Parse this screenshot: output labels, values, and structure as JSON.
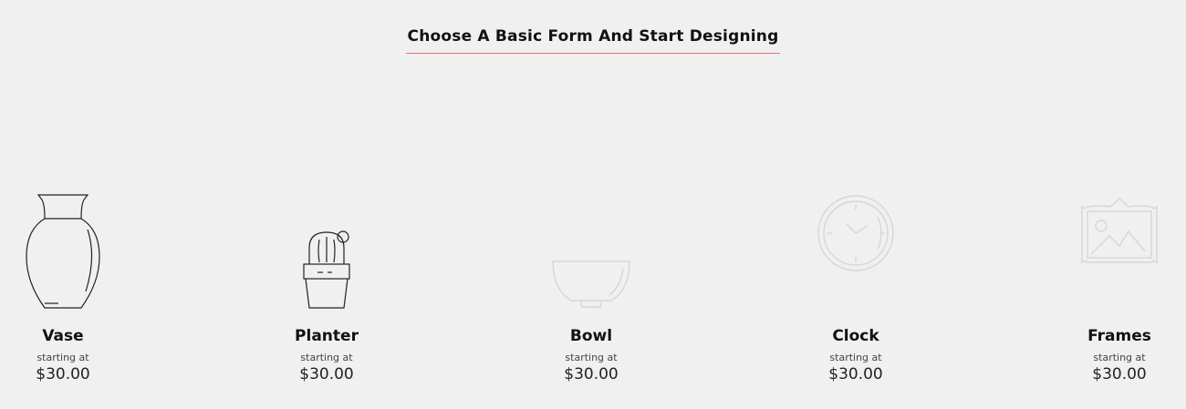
{
  "section": {
    "title": "Choose A Basic Form And Start Designing"
  },
  "products": [
    {
      "name": "Vase",
      "starting_label": "starting at",
      "price": "$30.00",
      "icon": "vase-icon"
    },
    {
      "name": "Planter",
      "starting_label": "starting at",
      "price": "$30.00",
      "icon": "cactus-planter-icon"
    },
    {
      "name": "Bowl",
      "starting_label": "starting at",
      "price": "$30.00",
      "icon": "bowl-icon"
    },
    {
      "name": "Clock",
      "starting_label": "starting at",
      "price": "$30.00",
      "icon": "clock-icon"
    },
    {
      "name": "Frames",
      "starting_label": "starting at",
      "price": "$30.00",
      "icon": "picture-frame-icon"
    }
  ],
  "colors": {
    "background": "#f0f0f0",
    "accent_underline": "#e57373",
    "icon_dark": "#222222",
    "icon_light": "#d6d6d6"
  }
}
